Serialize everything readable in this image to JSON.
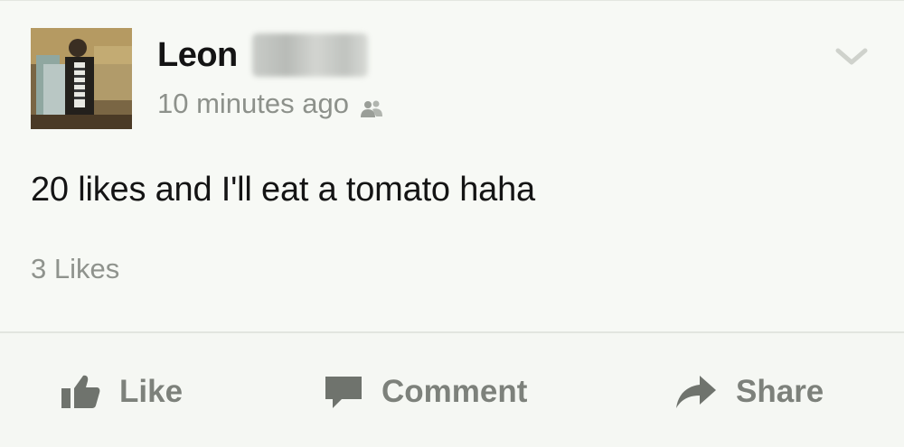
{
  "post": {
    "author_name": "Leon",
    "timestamp": "10 minutes ago",
    "audience_icon": "friends-icon",
    "text": "20 likes and I'll eat a tomato haha",
    "likes_count": "3 Likes",
    "options_icon": "chevron-down-icon"
  },
  "actions": {
    "like_label": "Like",
    "like_icon": "thumbs-up-icon",
    "comment_label": "Comment",
    "comment_icon": "speech-bubble-icon",
    "share_label": "Share",
    "share_icon": "share-arrow-icon"
  },
  "colors": {
    "background": "#f7f9f5",
    "primary_text": "#141414",
    "secondary_text": "#8d918b",
    "action_text": "#7d817b"
  }
}
